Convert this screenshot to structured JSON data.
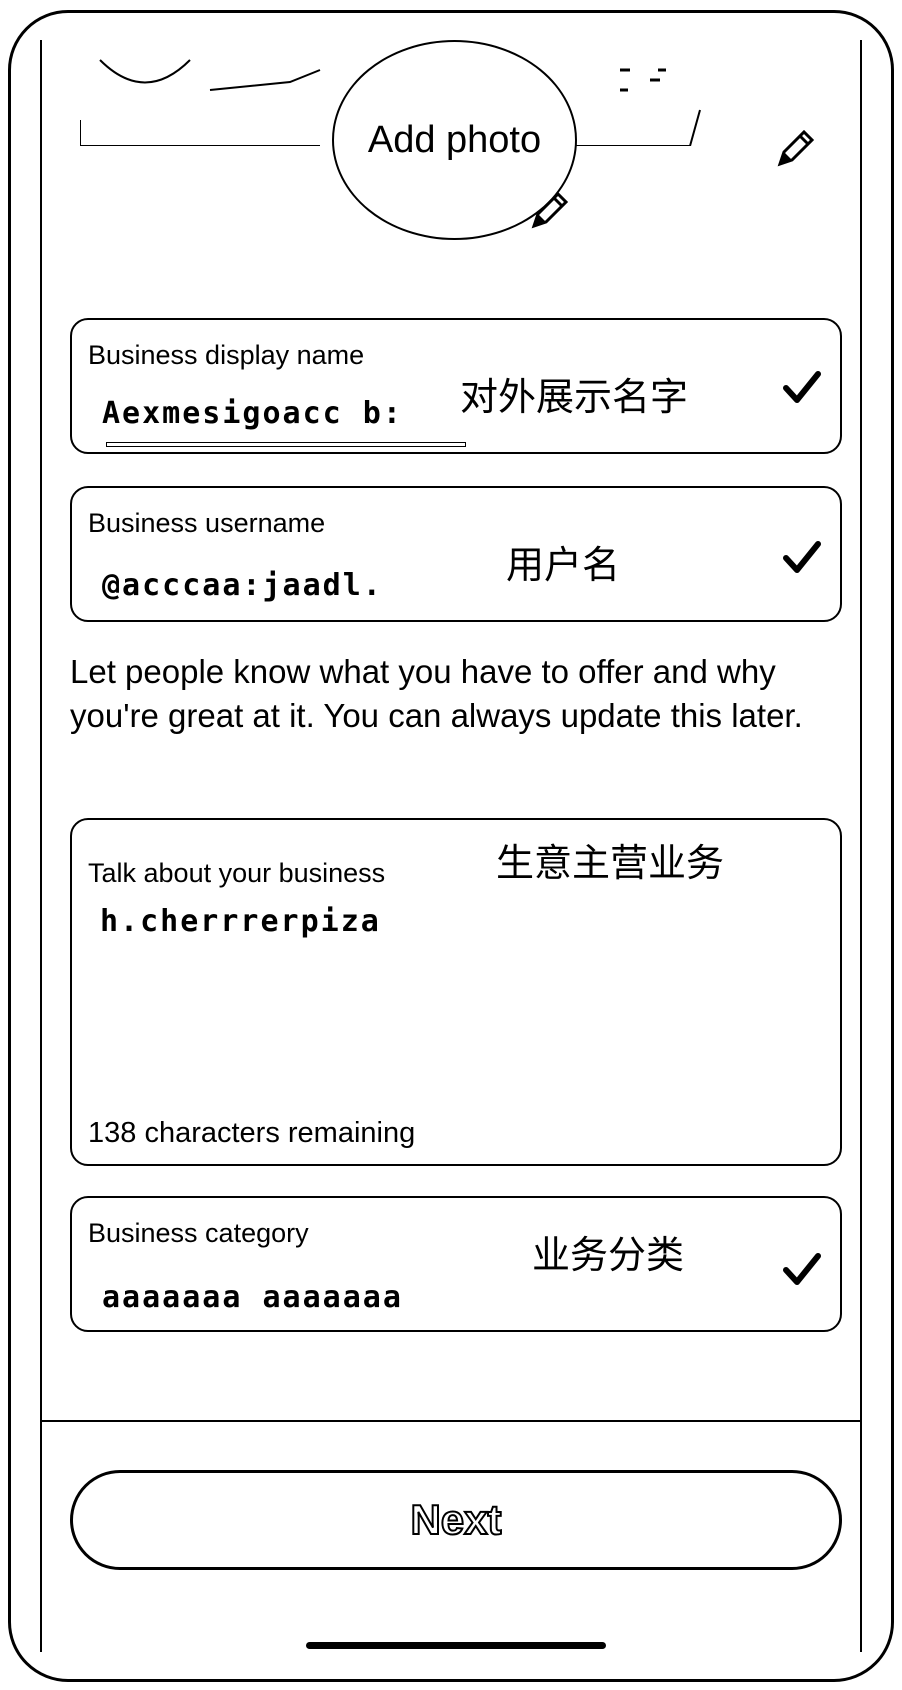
{
  "profile": {
    "add_photo_label": "Add photo"
  },
  "fields": {
    "display_name": {
      "label": "Business display name",
      "value": "Aexmesigoacc b:",
      "annotation": "对外展示名字"
    },
    "username": {
      "label": "Business username",
      "value": "@acccaa:jaadl.",
      "annotation": "用户名"
    },
    "about": {
      "label": "Talk about your business",
      "value": "h.cherrrerpiza",
      "annotation": "生意主营业务",
      "counter": "138 characters remaining"
    },
    "category": {
      "label": "Business category",
      "value": "aaaaaaa aaaaaaa",
      "annotation": "业务分类"
    }
  },
  "help_text": "Let people know what you have to offer and why you're great at it. You can always update this later.",
  "next_button": {
    "label": "Next"
  },
  "icons": {
    "edit": "pencil-icon",
    "valid": "checkmark-icon"
  }
}
